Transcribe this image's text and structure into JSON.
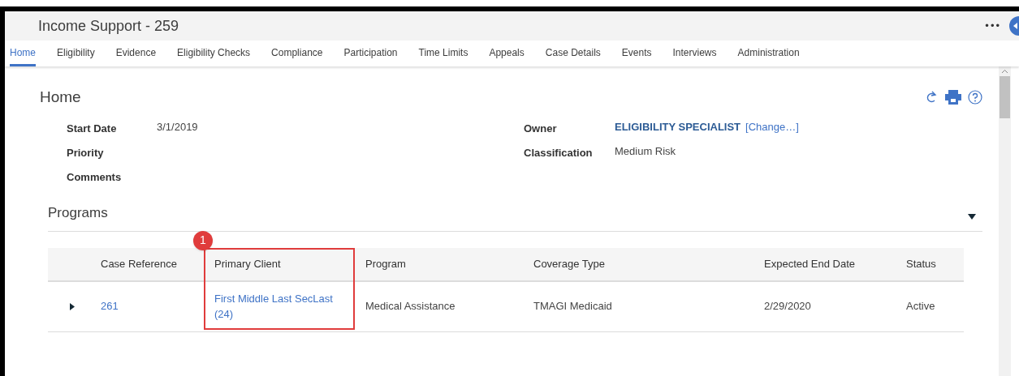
{
  "header": {
    "title": "Income Support - 259",
    "more": "•••"
  },
  "tabs": [
    {
      "label": "Home",
      "selected": true
    },
    {
      "label": "Eligibility",
      "selected": false
    },
    {
      "label": "Evidence",
      "selected": false
    },
    {
      "label": "Eligibility Checks",
      "selected": false
    },
    {
      "label": "Compliance",
      "selected": false
    },
    {
      "label": "Participation",
      "selected": false
    },
    {
      "label": "Time Limits",
      "selected": false
    },
    {
      "label": "Appeals",
      "selected": false
    },
    {
      "label": "Case Details",
      "selected": false
    },
    {
      "label": "Events",
      "selected": false
    },
    {
      "label": "Interviews",
      "selected": false
    },
    {
      "label": "Administration",
      "selected": false
    }
  ],
  "page": {
    "title": "Home"
  },
  "details_left": [
    {
      "label": "Start Date",
      "value": "3/1/2019"
    },
    {
      "label": "Priority"
    },
    {
      "label": "Comments"
    }
  ],
  "details_right": [
    {
      "label": "Owner",
      "value": "ELIGIBILITY SPECIALIST",
      "link": "[Change…]"
    },
    {
      "label": "Classification",
      "value": "Medium Risk"
    }
  ],
  "programs": {
    "title": "Programs",
    "expanded": true,
    "columns": [
      {
        "label": "Case Reference",
        "highlighted": false
      },
      {
        "label": "Primary Client",
        "highlighted": true
      },
      {
        "label": "Program",
        "highlighted": false
      },
      {
        "label": "Coverage Type",
        "highlighted": false
      },
      {
        "label": "Expected End Date",
        "highlighted": false
      },
      {
        "label": "Status",
        "highlighted": false
      }
    ],
    "rows": [
      {
        "expanded": false,
        "case_reference": "261",
        "primary_client": "First Middle Last SecLast (24)",
        "program": "Medical Assistance",
        "coverage_type": "TMAGI Medicaid",
        "expected_end_date": "2/29/2020",
        "status": "Active"
      }
    ]
  },
  "annotation": {
    "number": "1"
  }
}
